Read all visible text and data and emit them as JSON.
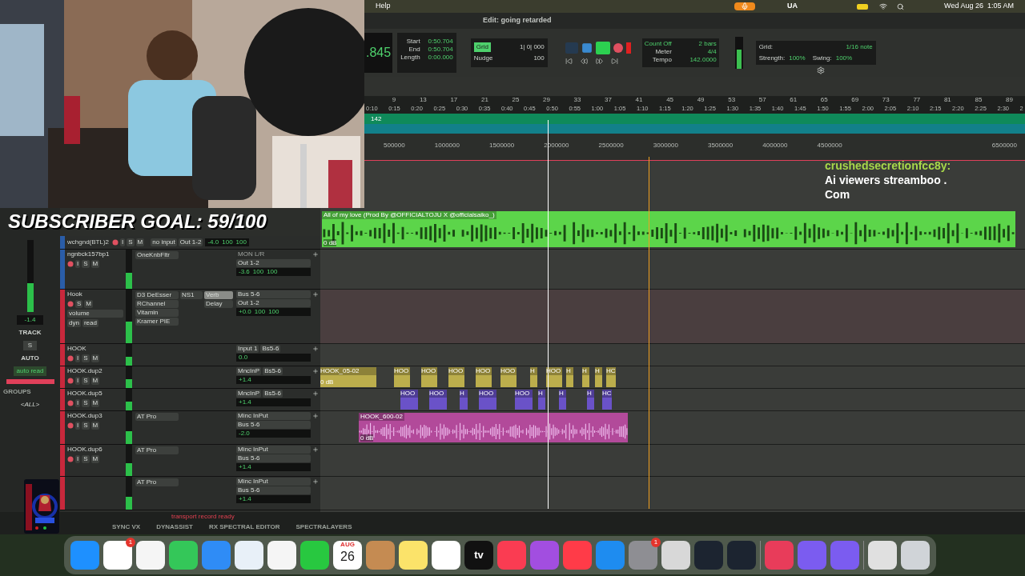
{
  "overlay": {
    "subscriber_goal": "SUBSCRIBER GOAL: 59/100",
    "chat_user": "crushedsecretionfcc8y:",
    "chat_message": [
      "Ai viewers streamboo .",
      "Com"
    ]
  },
  "menu_bar": {
    "menu": "Help",
    "ua": "UA",
    "clock": "Wed Aug 26  1:05 AM"
  },
  "window": {
    "title": "Edit: going retarded"
  },
  "counter": {
    "main": ".845",
    "labels": [
      "Start",
      "End",
      "Length"
    ],
    "values": [
      "0:50.704",
      "0:50.704",
      "0:00.000"
    ]
  },
  "grid_nudge": {
    "grid_label": "Grid",
    "grid_value": "1| 0| 000",
    "nudge_label": "Nudge",
    "nudge_value": "100"
  },
  "transport": {
    "online": true
  },
  "midi": {
    "labels": [
      "Count Off",
      "Meter",
      "Tempo"
    ],
    "values": [
      "2 bars",
      "4/4",
      "142.0000"
    ]
  },
  "quantize": {
    "grid_label": "Grid:",
    "grid_value": "1/16 note",
    "strength_label": "Strength:",
    "strength": "100%",
    "swing_label": "Swing:",
    "swing": "100%"
  },
  "ruler": {
    "bars": [
      "9",
      "13",
      "17",
      "21",
      "25",
      "29",
      "33",
      "37",
      "41",
      "45",
      "49",
      "53",
      "57",
      "61",
      "65",
      "69",
      "73",
      "77",
      "81",
      "85",
      "89"
    ],
    "timecode": [
      "0:10",
      "0:15",
      "0:20",
      "0:25",
      "0:30",
      "0:35",
      "0:40",
      "0:45",
      "0:50",
      "0:55",
      "1:00",
      "1:05",
      "1:10",
      "1:15",
      "1:20",
      "1:25",
      "1:30",
      "1:35",
      "1:40",
      "1:45",
      "1:50",
      "1:55",
      "2:00",
      "2:05",
      "2:10",
      "2:15",
      "2:20",
      "2:25",
      "2:30",
      "2"
    ],
    "tempo": "142",
    "samples": [
      "500000",
      "1000000",
      "1500000",
      "2000000",
      "2500000",
      "3000000",
      "3500000",
      "4000000",
      "4500000",
      "6500000"
    ]
  },
  "mix": {
    "value": "-1.4",
    "track": "TRACK",
    "solo": "S",
    "auto": "AUTO",
    "auto_mode": "auto read",
    "groups": "GROUPS",
    "group_all": "<ALL>"
  },
  "tracks": [
    {
      "name": "wchgnd(BTL)2",
      "color": "#2a5da8",
      "buttons": [
        "I",
        "S",
        "M"
      ],
      "io": [
        "no input",
        "Out 1-2"
      ],
      "vol": "-4.0",
      "pan": [
        "100",
        "100"
      ],
      "lane": {
        "kind": "audio",
        "color": "#5cd54a",
        "name": "All of my love (Prod By @OFFICIALTOJU X @officialsaiko_)",
        "gain": "0 dB"
      }
    },
    {
      "name": "ngnbck157bp1",
      "color": "#2a5da8",
      "buttons": [
        "I",
        "S",
        "M"
      ],
      "inserts": [
        "OneKnbFltr"
      ],
      "io": [
        "MON L/R",
        "Out 1-2"
      ],
      "io_disabled": true,
      "vol": "-3.6",
      "pan": [
        "100",
        "100"
      ]
    },
    {
      "name": "Hook",
      "color": "#c8283c",
      "buttons": [
        "S",
        "M"
      ],
      "mode": "volume",
      "auto_labels": [
        "dyn",
        "read"
      ],
      "inserts": [
        "D3 DeEsser",
        "RChannel",
        "Vitamin",
        "Kramer PIE"
      ],
      "inserts_2": [
        "NS1"
      ],
      "sends": [
        "Verb",
        "Delay"
      ],
      "io": [
        "Bus 5-6",
        "Out 1-2"
      ],
      "vol": "+0.0",
      "pan": [
        "100",
        "100"
      ],
      "lane": {
        "kind": "empty",
        "color": "#4a3e3f"
      }
    },
    {
      "name": "HOOK",
      "color": "#c8283c",
      "buttons": [
        "I",
        "S",
        "M"
      ],
      "io": [
        "Input 1",
        "Bs5-6"
      ],
      "vol": "0.0"
    },
    {
      "name": "HOOK.dup2",
      "color": "#c8283c",
      "buttons": [
        "I",
        "S",
        "M"
      ],
      "io": [
        "MncInP",
        "Bs5-6"
      ],
      "vol": "+1.4",
      "lane": {
        "kind": "clips",
        "color": "#bcae4c",
        "clips": [
          "HOOK_05-02",
          "HOO",
          "HOO",
          "HOO",
          "HOO",
          "HOO",
          "H",
          "HOO",
          "H",
          "H",
          "H",
          "HC"
        ],
        "gain": "0 dB"
      }
    },
    {
      "name": "HOOK.dup5",
      "color": "#c8283c",
      "buttons": [
        "I",
        "S",
        "M"
      ],
      "io": [
        "MncInP",
        "Bs5-6"
      ],
      "vol": "+1.4",
      "lane": {
        "kind": "clips",
        "color": "#6a52c8",
        "clips": [
          "HOO",
          "HOO",
          "H",
          "HOO",
          "HOO",
          "H",
          "H",
          "H",
          "HC"
        ]
      }
    },
    {
      "name": "HOOK.dup3",
      "color": "#c8283c",
      "buttons": [
        "I",
        "S",
        "M"
      ],
      "inserts": [
        "AT Pro"
      ],
      "io": [
        "Minc InPut",
        "Bus 5-6"
      ],
      "vol": "-2.0",
      "lane": {
        "kind": "audio",
        "color": "#b24a9a",
        "name": "HOOK_600-02",
        "gain": "0 dB"
      }
    },
    {
      "name": "HOOK.dup6",
      "color": "#c8283c",
      "buttons": [
        "I",
        "S",
        "M"
      ],
      "inserts": [
        "AT Pro"
      ],
      "io": [
        "Minc InPut",
        "Bus 5-6"
      ],
      "vol": "+1.4"
    },
    {
      "color": "#c8283c",
      "inserts": [
        "AT Pro"
      ],
      "io": [
        "Minc InPut",
        "Bus 5-6"
      ],
      "vol": "+1.4"
    }
  ],
  "status": {
    "message": "transport record ready",
    "plugins": [
      "SYNC VX",
      "DYNASSIST",
      "RX SPECTRAL EDITOR",
      "SPECTRALAYERS"
    ]
  },
  "dock": [
    {
      "kind": "app",
      "color": "#1e90ff"
    },
    {
      "kind": "app",
      "color": "#ffffff",
      "badge": "1"
    },
    {
      "kind": "app",
      "color": "#f5f5f5"
    },
    {
      "kind": "app",
      "color": "#34c759"
    },
    {
      "kind": "app",
      "color": "#2f8cf6"
    },
    {
      "kind": "app",
      "color": "#e8f0f8"
    },
    {
      "kind": "app",
      "color": "#f5f5f5"
    },
    {
      "kind": "app",
      "color": "#28c840"
    },
    {
      "kind": "calendar",
      "color": "#ffffff",
      "month": "AUG",
      "day": "26"
    },
    {
      "kind": "app",
      "color": "#c58b52"
    },
    {
      "kind": "app",
      "color": "#fbe36a"
    },
    {
      "kind": "app",
      "color": "#ffffff"
    },
    {
      "kind": "tv",
      "color": "#111111",
      "label": "tv"
    },
    {
      "kind": "app",
      "color": "#fa3c52"
    },
    {
      "kind": "app",
      "color": "#a24ee0"
    },
    {
      "kind": "app",
      "color": "#ff3b48"
    },
    {
      "kind": "app",
      "color": "#1e8cf0"
    },
    {
      "kind": "app",
      "color": "#8e8e93",
      "badge": "1"
    },
    {
      "kind": "app",
      "color": "#d8d8d8"
    },
    {
      "kind": "app",
      "color": "#1c2430"
    },
    {
      "kind": "app",
      "color": "#1c2430"
    },
    {
      "kind": "separator"
    },
    {
      "kind": "app",
      "color": "#e83c5a"
    },
    {
      "kind": "app",
      "color": "#7b5cf0"
    },
    {
      "kind": "app",
      "color": "#7b5cf0"
    },
    {
      "kind": "separator"
    },
    {
      "kind": "app",
      "color": "#e0e0e0"
    },
    {
      "kind": "app",
      "color": "#d0d4d8"
    }
  ]
}
